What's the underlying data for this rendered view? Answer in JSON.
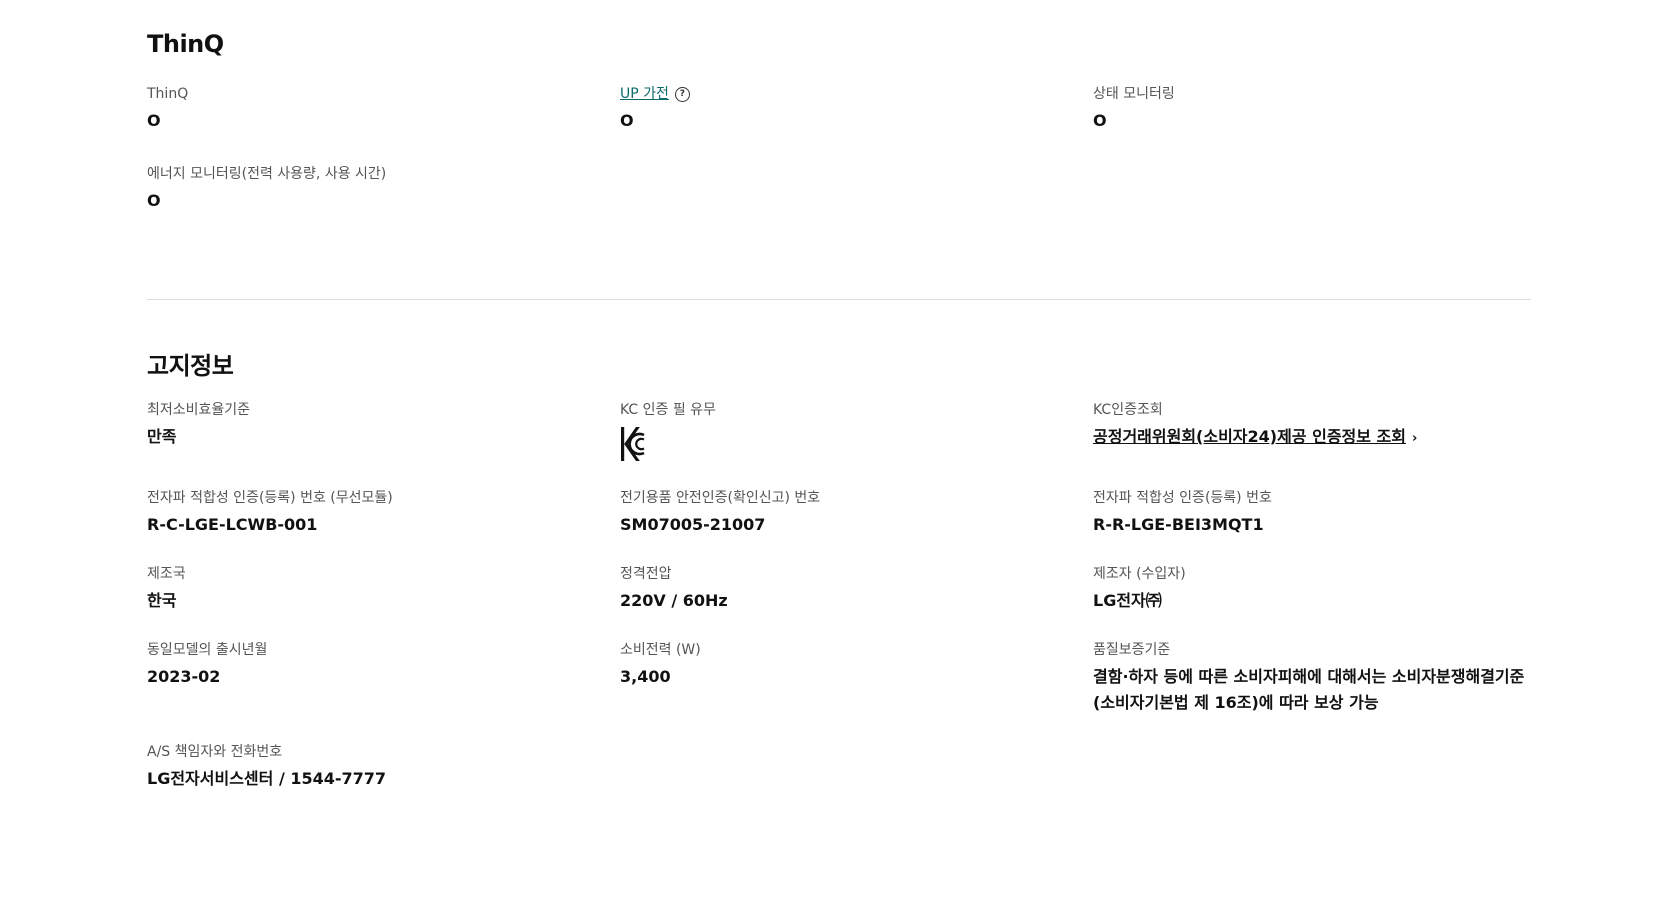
{
  "thinq_section": {
    "title": "ThinQ",
    "items": [
      {
        "label": "ThinQ",
        "value": "O"
      },
      {
        "label": "UP 가전",
        "value": "O"
      },
      {
        "label": "상태 모니터링",
        "value": "O"
      },
      {
        "label": "에너지 모니터링(전력 사용량, 사용 시간)",
        "value": "O"
      }
    ]
  },
  "notice_section": {
    "title": "고지정보",
    "items": [
      {
        "label": "최저소비효율기준",
        "value": "만족"
      },
      {
        "label": "KC 인증 필 유무",
        "value": "KC"
      },
      {
        "label": "KC인증조회",
        "value": "공정거래위원회(소비자24)제공 인증정보 조회"
      },
      {
        "label": "전자파 적합성 인증(등록) 번호 (무선모듈)",
        "value": "R-C-LGE-LCWB-001"
      },
      {
        "label": "전기용품 안전인증(확인신고) 번호",
        "value": "SM07005-21007"
      },
      {
        "label": "전자파 적합성 인증(등록) 번호",
        "value": "R-R-LGE-BEI3MQT1"
      },
      {
        "label": "제조국",
        "value": "한국"
      },
      {
        "label": "정격전압",
        "value": "220V / 60Hz"
      },
      {
        "label": "제조자 (수입자)",
        "value": "LG전자㈜"
      },
      {
        "label": "동일모델의 출시년월",
        "value": "2023-02"
      },
      {
        "label": "소비전력 (W)",
        "value": "3,400"
      },
      {
        "label": "품질보증기준",
        "value": "결함·하자 등에 따른 소비자피해에 대해서는 소비자분쟁해결기준 (소비자기본법 제 16조)에 따라 보상 가능"
      },
      {
        "label": "A/S 책임자와 전화번호",
        "value": "LG전자서비스센터 / 1544-7777"
      }
    ]
  },
  "icons": {
    "help": "help-circle-icon",
    "chevron": "chevron-right-icon",
    "kc": "kc-certification-mark"
  },
  "colors": {
    "link_teal": "#0b6a6a",
    "label_gray": "#555555",
    "text": "#111111",
    "divider": "#dddddd"
  }
}
